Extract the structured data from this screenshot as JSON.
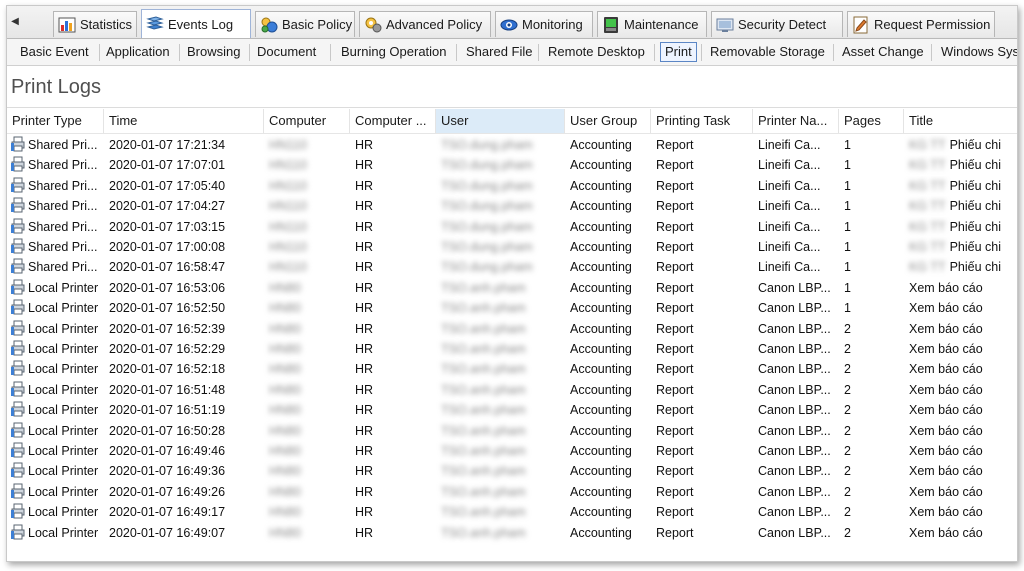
{
  "main_tabs": [
    {
      "label": "Statistics",
      "icon": "bar-chart-icon",
      "active": false
    },
    {
      "label": "Events Log",
      "icon": "events-log-icon",
      "active": true
    },
    {
      "label": "Basic Policy",
      "icon": "basic-policy-icon",
      "active": false
    },
    {
      "label": "Advanced Policy",
      "icon": "advanced-policy-icon",
      "active": false
    },
    {
      "label": "Monitoring",
      "icon": "monitoring-icon",
      "active": false
    },
    {
      "label": "Maintenance",
      "icon": "maintenance-icon",
      "active": false
    },
    {
      "label": "Security Detect",
      "icon": "security-detect-icon",
      "active": false
    },
    {
      "label": "Request Permission",
      "icon": "request-permission-icon",
      "active": false
    }
  ],
  "sub_tabs": [
    {
      "label": "Basic Event"
    },
    {
      "label": "Application"
    },
    {
      "label": "Browsing"
    },
    {
      "label": "Document"
    },
    {
      "label": "Burning Operation"
    },
    {
      "label": "Shared File"
    },
    {
      "label": "Remote Desktop"
    },
    {
      "label": "Print",
      "active": true
    },
    {
      "label": "Removable Storage"
    },
    {
      "label": "Asset Change"
    },
    {
      "label": "Windows Sys"
    }
  ],
  "page_title": "Print Logs",
  "columns": [
    "Printer Type",
    "Time",
    "Computer",
    "Computer ...",
    "User",
    "User Group",
    "Printing Task",
    "Printer Na...",
    "Pages",
    "Title"
  ],
  "rows": [
    {
      "printer_type": "Shared Pri...",
      "time": "2020-01-07 17:21:34",
      "computer": "HN110",
      "group_c": "HR",
      "user": "TSO.dung.pham",
      "user_group": "Accounting",
      "task": "Report",
      "printer_name": "Lineifi Ca...",
      "pages": "1",
      "title_prefix": "KG TT",
      "title": "Phiếu chi"
    },
    {
      "printer_type": "Shared Pri...",
      "time": "2020-01-07 17:07:01",
      "computer": "HN110",
      "group_c": "HR",
      "user": "TSO.dung.pham",
      "user_group": "Accounting",
      "task": "Report",
      "printer_name": "Lineifi Ca...",
      "pages": "1",
      "title_prefix": "KG TT",
      "title": "Phiếu chi"
    },
    {
      "printer_type": "Shared Pri...",
      "time": "2020-01-07 17:05:40",
      "computer": "HN110",
      "group_c": "HR",
      "user": "TSO.dung.pham",
      "user_group": "Accounting",
      "task": "Report",
      "printer_name": "Lineifi Ca...",
      "pages": "1",
      "title_prefix": "KG TT",
      "title": "Phiếu chi"
    },
    {
      "printer_type": "Shared Pri...",
      "time": "2020-01-07 17:04:27",
      "computer": "HN110",
      "group_c": "HR",
      "user": "TSO.dung.pham",
      "user_group": "Accounting",
      "task": "Report",
      "printer_name": "Lineifi Ca...",
      "pages": "1",
      "title_prefix": "KG TT",
      "title": "Phiếu chi"
    },
    {
      "printer_type": "Shared Pri...",
      "time": "2020-01-07 17:03:15",
      "computer": "HN110",
      "group_c": "HR",
      "user": "TSO.dung.pham",
      "user_group": "Accounting",
      "task": "Report",
      "printer_name": "Lineifi Ca...",
      "pages": "1",
      "title_prefix": "KG TT",
      "title": "Phiếu chi"
    },
    {
      "printer_type": "Shared Pri...",
      "time": "2020-01-07 17:00:08",
      "computer": "HN110",
      "group_c": "HR",
      "user": "TSO.dung.pham",
      "user_group": "Accounting",
      "task": "Report",
      "printer_name": "Lineifi Ca...",
      "pages": "1",
      "title_prefix": "KG TT",
      "title": "Phiếu chi"
    },
    {
      "printer_type": "Shared Pri...",
      "time": "2020-01-07 16:58:47",
      "computer": "HN110",
      "group_c": "HR",
      "user": "TSO.dung.pham",
      "user_group": "Accounting",
      "task": "Report",
      "printer_name": "Lineifi Ca...",
      "pages": "1",
      "title_prefix": "KG TT",
      "title": "Phiếu chi"
    },
    {
      "printer_type": "Local Printer",
      "time": "2020-01-07 16:53:06",
      "computer": "HN80",
      "group_c": "HR",
      "user": "TSO.anh.pham",
      "user_group": "Accounting",
      "task": "Report",
      "printer_name": "Canon LBP...",
      "pages": "1",
      "title_prefix": "",
      "title": "Xem báo cáo"
    },
    {
      "printer_type": "Local Printer",
      "time": "2020-01-07 16:52:50",
      "computer": "HN80",
      "group_c": "HR",
      "user": "TSO.anh.pham",
      "user_group": "Accounting",
      "task": "Report",
      "printer_name": "Canon LBP...",
      "pages": "1",
      "title_prefix": "",
      "title": "Xem báo cáo"
    },
    {
      "printer_type": "Local Printer",
      "time": "2020-01-07 16:52:39",
      "computer": "HN80",
      "group_c": "HR",
      "user": "TSO.anh.pham",
      "user_group": "Accounting",
      "task": "Report",
      "printer_name": "Canon LBP...",
      "pages": "2",
      "title_prefix": "",
      "title": "Xem báo cáo"
    },
    {
      "printer_type": "Local Printer",
      "time": "2020-01-07 16:52:29",
      "computer": "HN80",
      "group_c": "HR",
      "user": "TSO.anh.pham",
      "user_group": "Accounting",
      "task": "Report",
      "printer_name": "Canon LBP...",
      "pages": "2",
      "title_prefix": "",
      "title": "Xem báo cáo"
    },
    {
      "printer_type": "Local Printer",
      "time": "2020-01-07 16:52:18",
      "computer": "HN80",
      "group_c": "HR",
      "user": "TSO.anh.pham",
      "user_group": "Accounting",
      "task": "Report",
      "printer_name": "Canon LBP...",
      "pages": "2",
      "title_prefix": "",
      "title": "Xem báo cáo"
    },
    {
      "printer_type": "Local Printer",
      "time": "2020-01-07 16:51:48",
      "computer": "HN80",
      "group_c": "HR",
      "user": "TSO.anh.pham",
      "user_group": "Accounting",
      "task": "Report",
      "printer_name": "Canon LBP...",
      "pages": "2",
      "title_prefix": "",
      "title": "Xem báo cáo"
    },
    {
      "printer_type": "Local Printer",
      "time": "2020-01-07 16:51:19",
      "computer": "HN80",
      "group_c": "HR",
      "user": "TSO.anh.pham",
      "user_group": "Accounting",
      "task": "Report",
      "printer_name": "Canon LBP...",
      "pages": "2",
      "title_prefix": "",
      "title": "Xem báo cáo"
    },
    {
      "printer_type": "Local Printer",
      "time": "2020-01-07 16:50:28",
      "computer": "HN80",
      "group_c": "HR",
      "user": "TSO.anh.pham",
      "user_group": "Accounting",
      "task": "Report",
      "printer_name": "Canon LBP...",
      "pages": "2",
      "title_prefix": "",
      "title": "Xem báo cáo"
    },
    {
      "printer_type": "Local Printer",
      "time": "2020-01-07 16:49:46",
      "computer": "HN80",
      "group_c": "HR",
      "user": "TSO.anh.pham",
      "user_group": "Accounting",
      "task": "Report",
      "printer_name": "Canon LBP...",
      "pages": "2",
      "title_prefix": "",
      "title": "Xem báo cáo"
    },
    {
      "printer_type": "Local Printer",
      "time": "2020-01-07 16:49:36",
      "computer": "HN80",
      "group_c": "HR",
      "user": "TSO.anh.pham",
      "user_group": "Accounting",
      "task": "Report",
      "printer_name": "Canon LBP...",
      "pages": "2",
      "title_prefix": "",
      "title": "Xem báo cáo"
    },
    {
      "printer_type": "Local Printer",
      "time": "2020-01-07 16:49:26",
      "computer": "HN80",
      "group_c": "HR",
      "user": "TSO.anh.pham",
      "user_group": "Accounting",
      "task": "Report",
      "printer_name": "Canon LBP...",
      "pages": "2",
      "title_prefix": "",
      "title": "Xem báo cáo"
    },
    {
      "printer_type": "Local Printer",
      "time": "2020-01-07 16:49:17",
      "computer": "HN80",
      "group_c": "HR",
      "user": "TSO.anh.pham",
      "user_group": "Accounting",
      "task": "Report",
      "printer_name": "Canon LBP...",
      "pages": "2",
      "title_prefix": "",
      "title": "Xem báo cáo"
    },
    {
      "printer_type": "Local Printer",
      "time": "2020-01-07 16:49:07",
      "computer": "HN80",
      "group_c": "HR",
      "user": "TSO.anh.pham",
      "user_group": "Accounting",
      "task": "Report",
      "printer_name": "Canon LBP...",
      "pages": "2",
      "title_prefix": "",
      "title": "Xem báo cáo"
    }
  ],
  "colors": {
    "accent": "#5b86c5",
    "sorted_header": "#dcebf8"
  }
}
